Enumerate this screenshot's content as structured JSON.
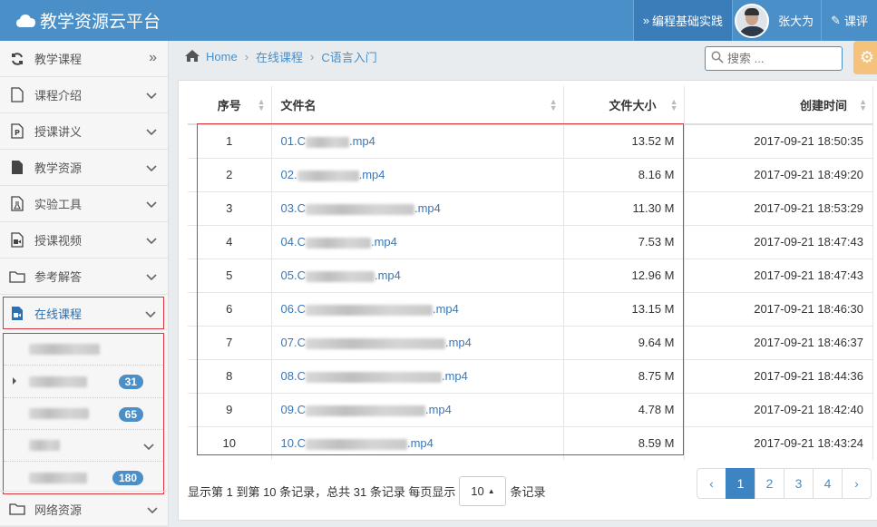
{
  "header": {
    "title": "教学资源云平台",
    "link_label": "编程基础实践",
    "user_name": "张大为",
    "eval_label": "课评"
  },
  "sidebar": {
    "items": [
      {
        "label": "教学课程",
        "icon": "refresh-icon",
        "chev": "»"
      },
      {
        "label": "课程介绍",
        "icon": "document-icon",
        "chev": "⌄"
      },
      {
        "label": "授课讲义",
        "icon": "presentation-icon",
        "chev": "⌄"
      },
      {
        "label": "教学资源",
        "icon": "file-icon",
        "chev": "⌄"
      },
      {
        "label": "实验工具",
        "icon": "flask-icon",
        "chev": "⌄"
      },
      {
        "label": "授课视频",
        "icon": "video-icon",
        "chev": "⌄"
      },
      {
        "label": "参考解答",
        "icon": "folder-icon",
        "chev": "⌄"
      }
    ],
    "active": {
      "label": "在线课程",
      "icon": "video-file-icon"
    },
    "sub_badges": [
      "31",
      "65",
      "180"
    ],
    "last": {
      "label": "网络资源",
      "icon": "folder-icon"
    }
  },
  "breadcrumb": {
    "home": "Home",
    "level1": "在线课程",
    "current": "C语言入门"
  },
  "search": {
    "placeholder": "搜索 ..."
  },
  "table": {
    "headers": {
      "no": "序号",
      "name": "文件名",
      "size": "文件大小",
      "time": "创建时间"
    },
    "rows": [
      {
        "no": "1",
        "prefix": "01.C",
        "suffix": ".mp4",
        "size": "13.52 M",
        "time": "2017-09-21 18:50:35"
      },
      {
        "no": "2",
        "prefix": "02.",
        "suffix": ".mp4",
        "size": "8.16 M",
        "time": "2017-09-21 18:49:20"
      },
      {
        "no": "3",
        "prefix": "03.C",
        "suffix": ".mp4",
        "size": "11.30 M",
        "time": "2017-09-21 18:53:29"
      },
      {
        "no": "4",
        "prefix": "04.C",
        "suffix": ".mp4",
        "size": "7.53 M",
        "time": "2017-09-21 18:47:43"
      },
      {
        "no": "5",
        "prefix": "05.C",
        "suffix": ".mp4",
        "size": "12.96 M",
        "time": "2017-09-21 18:47:43"
      },
      {
        "no": "6",
        "prefix": "06.C",
        "suffix": ".mp4",
        "size": "13.15 M",
        "time": "2017-09-21 18:46:30"
      },
      {
        "no": "7",
        "prefix": "07.C",
        "suffix": ".mp4",
        "size": "9.64 M",
        "time": "2017-09-21 18:46:37"
      },
      {
        "no": "8",
        "prefix": "08.C",
        "suffix": ".mp4",
        "size": "8.75 M",
        "time": "2017-09-21 18:44:36"
      },
      {
        "no": "9",
        "prefix": "09.C",
        "suffix": ".mp4",
        "size": "4.78 M",
        "time": "2017-09-21 18:42:40"
      },
      {
        "no": "10",
        "prefix": "10.C",
        "suffix": ".mp4",
        "size": "8.59 M",
        "time": "2017-09-21 18:43:24"
      }
    ]
  },
  "footer": {
    "info_left": "显示第 1 到第 10 条记录，总共 31 条记录 每页显示",
    "page_size": "10",
    "info_right": "条记录",
    "pages": [
      "‹",
      "1",
      "2",
      "3",
      "4",
      "›"
    ],
    "active_page": "1"
  },
  "colors": {
    "header": "#4a8fc7",
    "accent": "#3c84c2",
    "highlight": "#d9363e"
  }
}
